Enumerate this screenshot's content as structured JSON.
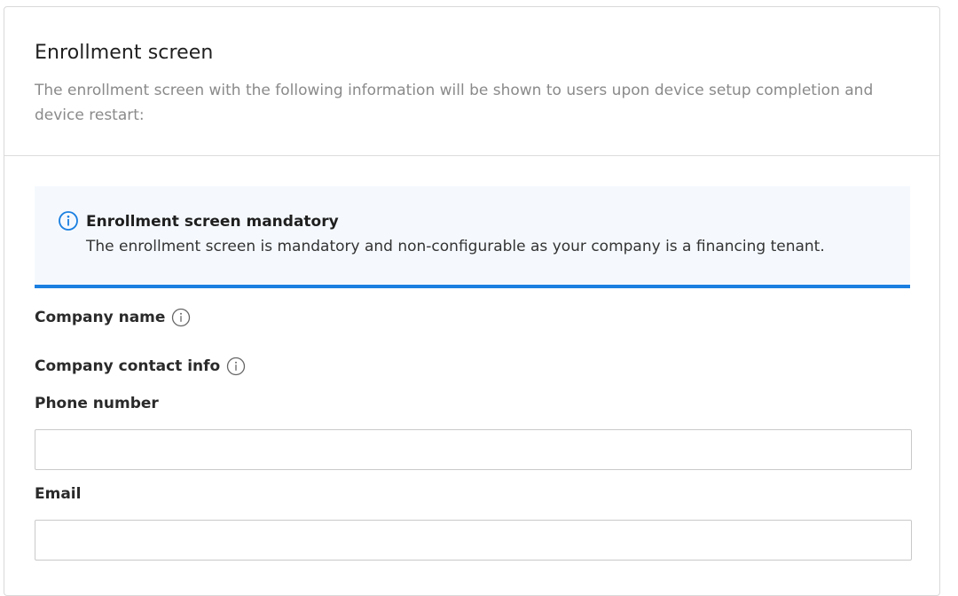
{
  "section": {
    "title": "Enrollment screen",
    "description": "The enrollment screen with the following information will be shown to users upon device setup completion and device restart:"
  },
  "notice": {
    "icon": "info-icon",
    "title": "Enrollment screen mandatory",
    "text": "The enrollment screen is mandatory and non-configurable as your company is a financing tenant.",
    "accent_color": "#1a7fe0"
  },
  "fields": {
    "company_name_label": "Company name",
    "company_contact_label": "Company contact info",
    "phone_label": "Phone number",
    "phone_value": "",
    "email_label": "Email",
    "email_value": ""
  }
}
